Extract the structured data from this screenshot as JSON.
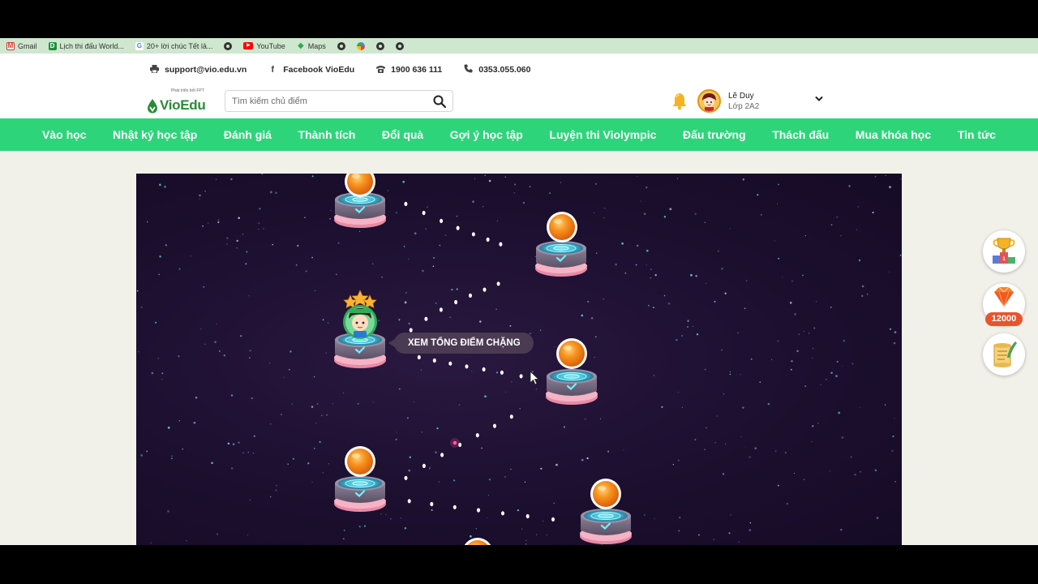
{
  "bookmarks": [
    {
      "label": "Gmail",
      "icon": "gmail-icon"
    },
    {
      "label": "Lịch thi đấu World...",
      "icon": "calendar-icon"
    },
    {
      "label": "20+ lời chúc Tết lả...",
      "icon": "google-icon"
    },
    {
      "label": "",
      "icon": "globe-icon"
    },
    {
      "label": "YouTube",
      "icon": "youtube-icon"
    },
    {
      "label": "Maps",
      "icon": "maps-icon"
    },
    {
      "label": "",
      "icon": "globe-icon"
    },
    {
      "label": "",
      "icon": "pinwheel-icon"
    },
    {
      "label": "",
      "icon": "globe-icon"
    },
    {
      "label": "",
      "icon": "globe-icon"
    }
  ],
  "contact": {
    "email": "support@vio.edu.vn",
    "facebook": "Facebook VioEdu",
    "hotline": "1900 636 111",
    "phone": "0353.055.060"
  },
  "header": {
    "logo_text": "VioEdu",
    "logo_small": "Phát triển bởi FPT",
    "search_placeholder": "Tìm kiếm chủ điểm",
    "user_name": "Lê Duy",
    "user_class": "Lớp 2A2"
  },
  "nav": [
    "Vào học",
    "Nhật ký học tập",
    "Đánh giá",
    "Thành tích",
    "Đổi quà",
    "Gợi ý học tập",
    "Luyện thi Violympic",
    "Đấu trường",
    "Thách đấu",
    "Mua khóa học",
    "Tin tức"
  ],
  "game": {
    "tooltip": "XEM TỔNG ĐIỂM CHẶNG",
    "current_stars": 3
  },
  "side": {
    "gem_count": "12000"
  },
  "colors": {
    "nav_green": "#2ed47a",
    "game_bg": "#1c0f2f",
    "orb_orange": "#f7931e",
    "pedestal_cyan": "#4fd6e6",
    "pedestal_pink": "#f19ab3"
  }
}
